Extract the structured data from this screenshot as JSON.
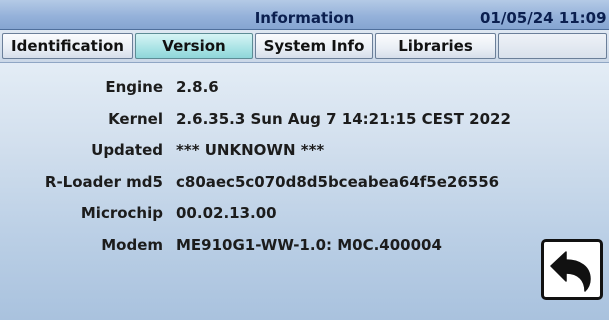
{
  "header": {
    "title": "Information",
    "datetime": "01/05/24 11:09"
  },
  "tabs": [
    {
      "label": "Identification",
      "active": false
    },
    {
      "label": "Version",
      "active": true
    },
    {
      "label": "System Info",
      "active": false
    },
    {
      "label": "Libraries",
      "active": false
    },
    {
      "label": "",
      "active": false
    }
  ],
  "info": [
    {
      "label": "Engine",
      "value": "2.8.6"
    },
    {
      "label": "Kernel",
      "value": "2.6.35.3 Sun Aug 7 14:21:15 CEST 2022"
    },
    {
      "label": "Updated",
      "value": "*** UNKNOWN ***"
    },
    {
      "label": "R-Loader md5",
      "value": "c80aec5c070d8d5bceabea64f5e26556"
    },
    {
      "label": "Microchip",
      "value": "00.02.13.00"
    },
    {
      "label": "Modem",
      "value": "ME910G1-WW-1.0: M0C.400004"
    }
  ],
  "back_button": {
    "icon": "back-arrow-icon"
  },
  "colors": {
    "title_bar": "#95b2da",
    "active_tab": "#a9e3e5",
    "text": "#1c1c1c"
  }
}
